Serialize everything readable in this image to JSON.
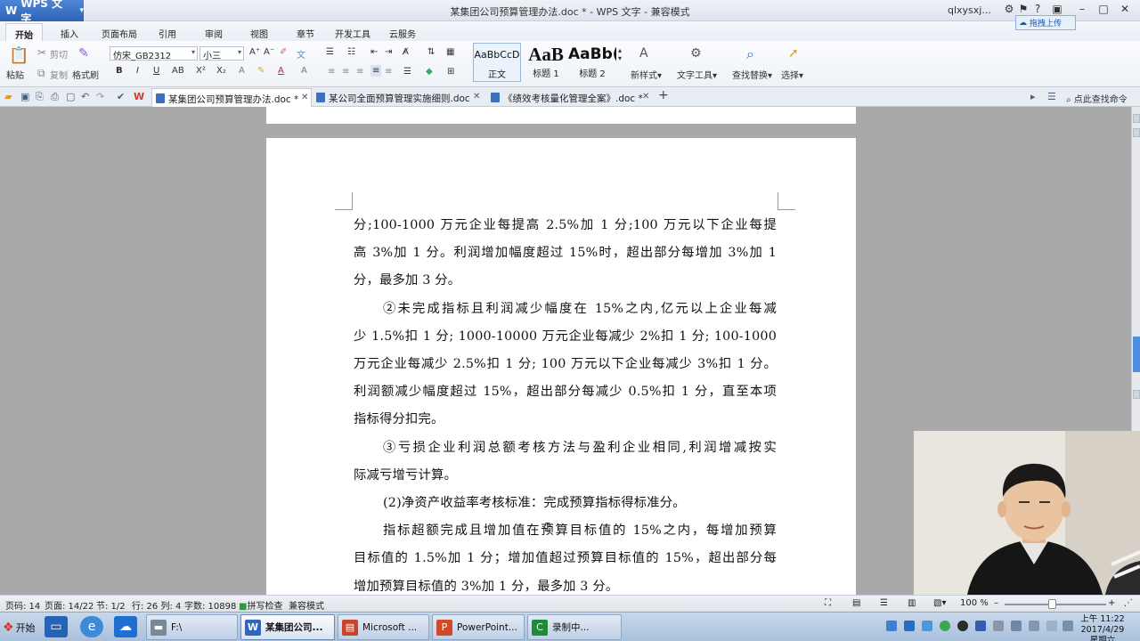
{
  "window": {
    "app_name": "WPS 文字",
    "title": "某集团公司预算管理办法.doc * - WPS 文字 - 兼容模式",
    "user": "qlxysxj...",
    "upload_label": "拖拽上传"
  },
  "menu": {
    "tabs": [
      "开始",
      "插入",
      "页面布局",
      "引用",
      "审阅",
      "视图",
      "章节",
      "开发工具",
      "云服务"
    ]
  },
  "ribbon": {
    "paste": "粘贴",
    "cut": "剪切",
    "copy": "复制",
    "format_painter": "格式刷",
    "font_name": "仿宋_GB2312",
    "font_size": "小三",
    "styles": [
      {
        "sample": "AaBbCcD",
        "label": "正文"
      },
      {
        "sample": "AaB",
        "label": "标题 1"
      },
      {
        "sample": "AaBb(",
        "label": "标题 2"
      }
    ],
    "new_style": "新样式",
    "text_tools": "文字工具",
    "find_replace": "查找替换",
    "select": "选择"
  },
  "doc_tabs": [
    {
      "label": "某集团公司预算管理办法.doc *",
      "active": true
    },
    {
      "label": "某公司全面预算管理实施细则.doc",
      "active": false
    },
    {
      "label": "《绩效考核量化管理全案》.doc *",
      "active": false
    }
  ],
  "find_command": "点此查找命令",
  "document": {
    "lines": [
      "分;100-1000 万元企业每提高 2.5%加 1 分;100 万元以下企业每提",
      "高 3%加 1 分。利润增加幅度超过 15%时，超出部分每增加 3%加 1",
      "分，最多加 3 分。",
      "②未完成指标且利润减少幅度在 15%之内,亿元以上企业每减",
      "少 1.5%扣 1 分; 1000-10000 万元企业每减少 2%扣 1 分; 100-1000",
      "万元企业每减少 2.5%扣 1 分; 100 万元以下企业每减少 3%扣 1 分。",
      "利润额减少幅度超过 15%，超出部分每减少 0.5%扣 1 分，直至本项",
      "指标得分扣完。",
      "③亏损企业利润总额考核方法与盈利企业相同,利润增减按实",
      "际减亏增亏计算。",
      "(2)净资产收益率考核标准：完成预算指标得标准分。",
      "指标超额完成且增加值在预算目标值的 15%之内，每增加预算",
      "目标值的 1.5%加 1 分；增加值超过预算目标值的 15%，超出部分每",
      "增加预算目标值的 3%加 1 分，最多加 3 分。"
    ]
  },
  "statusbar": {
    "page_code": "页码: 14",
    "page": "页面: 14/22",
    "section": "节: 1/2",
    "row_col": "行: 26  列: 4",
    "word_count": "字数: 10898",
    "spell": "拼写检查",
    "mode": "兼容模式",
    "zoom": "100 %"
  },
  "taskbar": {
    "start": "开始",
    "tasks": [
      {
        "label": "F:\\",
        "color": "#7a8797"
      },
      {
        "label": "某集团公司...",
        "color": "#2f66c0",
        "active": true
      },
      {
        "label": "Microsoft ...",
        "color": "#c8442a"
      },
      {
        "label": "PowerPoint...",
        "color": "#d04a2a"
      },
      {
        "label": "录制中...",
        "color": "#1f8a3a"
      }
    ],
    "clock_time": "上午 11:22",
    "clock_date": "2017/4/29 星期六"
  }
}
